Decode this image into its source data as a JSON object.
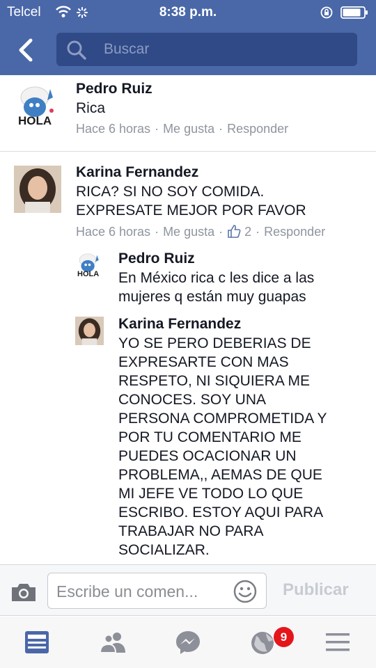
{
  "status_bar": {
    "carrier": "Telcel",
    "time": "8:38 p.m."
  },
  "search": {
    "placeholder": "Buscar"
  },
  "comments": [
    {
      "author": "Pedro Ruiz",
      "avatar_text": "HOLA",
      "text": "Rica",
      "time": "Hace 6 horas",
      "like_label": "Me gusta",
      "reply_label": "Responder"
    },
    {
      "author": "Karina Fernandez",
      "text": "RICA?  SI NO SOY COMIDA.\nEXPRESATE MEJOR POR FAVOR",
      "time": "Hace 6 horas",
      "like_label": "Me gusta",
      "like_count": "2",
      "reply_label": "Responder"
    }
  ],
  "replies": [
    {
      "author": "Pedro Ruiz",
      "avatar_text": "HOLA",
      "text": "En México rica c les dice a las\nmujeres q están muy guapas"
    },
    {
      "author": "Karina Fernandez",
      "text": "YO SE PERO DEBERIAS DE\nEXPRESARTE CON MAS\nRESPETO, NI SIQUIERA ME\nCONOCES. SOY UNA\nPERSONA COMPROMETIDA Y\nPOR TU COMENTARIO ME\nPUEDES OCACIONAR UN\nPROBLEMA,, AEMAS DE QUE\nMI JEFE VE TODO LO QUE\nESCRIBO. ESTOY AQUI PARA\nTRABAJAR NO PARA\nSOCIALIZAR."
    }
  ],
  "composer": {
    "placeholder": "Escribe un comen...",
    "publish_label": "Publicar"
  },
  "tabbar": {
    "items": [
      "news-feed-icon",
      "friends-icon",
      "messenger-icon",
      "notifications-globe-icon",
      "menu-icon"
    ],
    "notifications_badge": "9"
  },
  "colors": {
    "header_bg": "#4a68a8",
    "search_bg": "#2f4a86",
    "badge": "#e4161c",
    "tab_active": "#4a68a8",
    "tab_inactive": "#8d9099"
  }
}
